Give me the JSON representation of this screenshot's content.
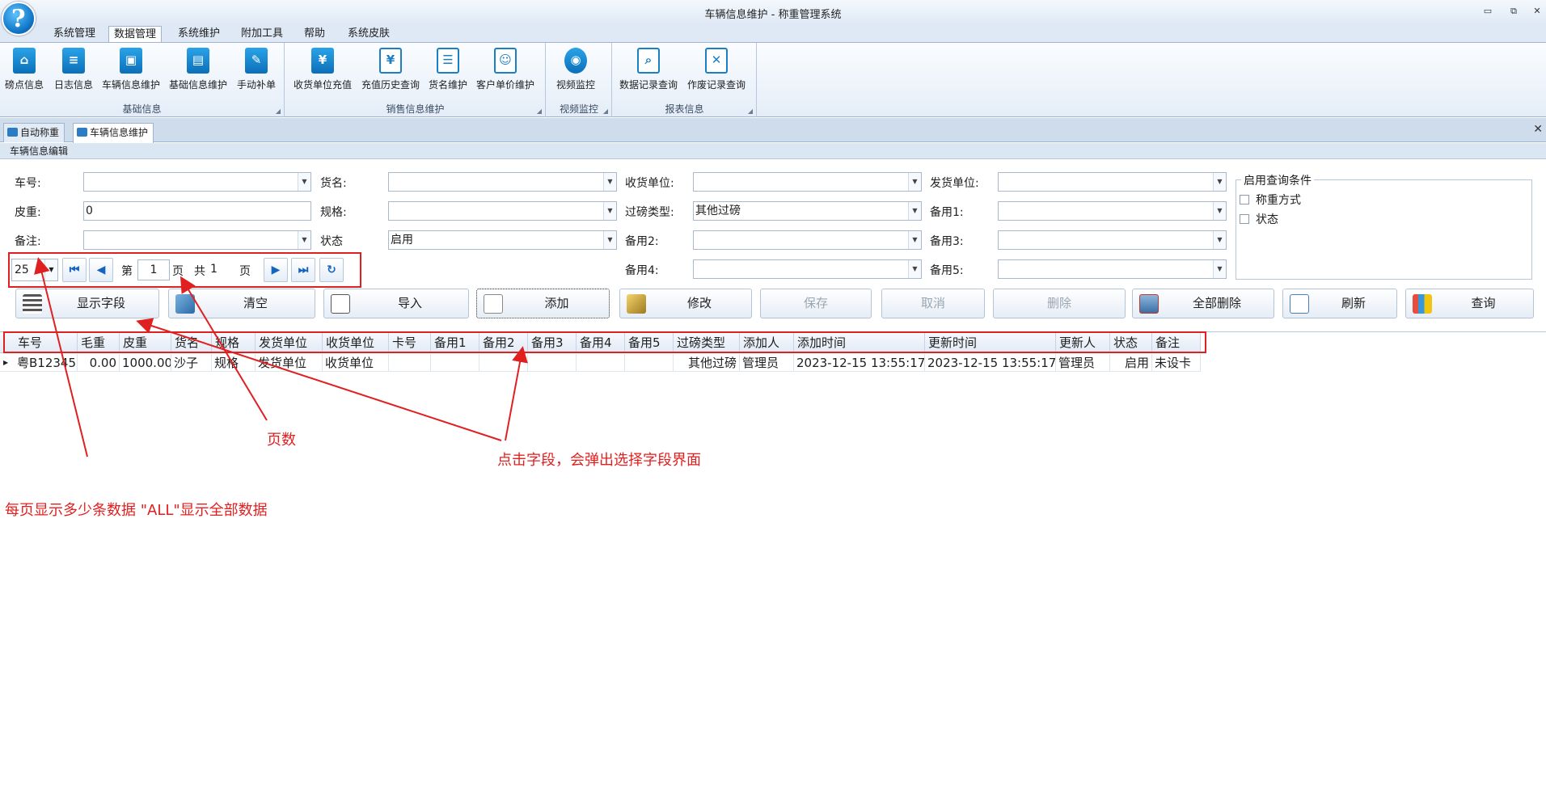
{
  "window": {
    "title": "车辆信息维护 - 称重管理系统",
    "minimize": "▭",
    "restore": "⧉",
    "close": "✕"
  },
  "menu": {
    "tabs": [
      "系统管理",
      "数据管理",
      "系统维护",
      "附加工具",
      "帮助",
      "系统皮肤"
    ],
    "active": "数据管理"
  },
  "ribbon": {
    "groups": [
      {
        "label": "基础信息",
        "buttons": [
          "磅点信息",
          "日志信息",
          "车辆信息维护",
          "基础信息维护",
          "手动补单"
        ]
      },
      {
        "label": "销售信息维护",
        "buttons": [
          "收货单位充值",
          "充值历史查询",
          "货名维护",
          "客户单价维护"
        ]
      },
      {
        "label": "视频监控",
        "buttons": [
          "视频监控"
        ]
      },
      {
        "label": "报表信息",
        "buttons": [
          "数据记录查询",
          "作废记录查询"
        ]
      }
    ],
    "icons": [
      "home-icon",
      "clipboard-icon",
      "truck-icon",
      "card-icon",
      "edit-icon",
      "wallet-icon",
      "yen-clock-icon",
      "goods-icon",
      "user-gear-icon",
      "camera-icon",
      "report-search-icon",
      "void-report-icon"
    ]
  },
  "doc_tabs": [
    "自动称重",
    "车辆信息维护"
  ],
  "doc_close": "✕",
  "section": {
    "title": "车辆信息编辑"
  },
  "form": {
    "labels": {
      "plate": "车号:",
      "goods": "货名:",
      "receiver": "收货单位:",
      "sender": "发货单位:",
      "tare": "皮重:",
      "spec": "规格:",
      "weigh_type": "过磅类型:",
      "backup1": "备用1:",
      "remark": "备注:",
      "status": "状态",
      "backup2": "备用2:",
      "backup3": "备用3:",
      "backup4": "备用4:",
      "backup5": "备用5:"
    },
    "values": {
      "plate": "",
      "goods": "",
      "receiver": "",
      "sender": "",
      "tare": "0",
      "spec": "",
      "weigh_type": "其他过磅",
      "backup1": "",
      "remark": "",
      "status": "启用",
      "backup2": "",
      "backup3": "",
      "backup4": "",
      "backup5": ""
    },
    "query_group": {
      "title": "启用查询条件",
      "options": [
        "称重方式",
        "状态"
      ]
    }
  },
  "pager": {
    "page_size": "25",
    "page_prefix": "第",
    "current_page": "1",
    "page_unit": "页",
    "total_prefix": "共",
    "total_pages": "1",
    "total_unit": "页",
    "buttons": {
      "first": "⏮",
      "prev": "◀",
      "next": "▶",
      "last": "⏭",
      "refresh": "↻"
    }
  },
  "actions": [
    {
      "label": "显示字段",
      "enabled": true,
      "icon": "columns-icon"
    },
    {
      "label": "清空",
      "enabled": true,
      "icon": "eraser-icon"
    },
    {
      "label": "导入",
      "enabled": true,
      "icon": "import-icon"
    },
    {
      "label": "添加",
      "enabled": true,
      "icon": "add-icon"
    },
    {
      "label": "修改",
      "enabled": true,
      "icon": "pencil-icon"
    },
    {
      "label": "保存",
      "enabled": false
    },
    {
      "label": "取消",
      "enabled": false
    },
    {
      "label": "删除",
      "enabled": false
    },
    {
      "label": "全部删除",
      "enabled": true,
      "icon": "delete-all-icon"
    },
    {
      "label": "刷新",
      "enabled": true,
      "icon": "refresh-icon"
    },
    {
      "label": "查询",
      "enabled": true,
      "icon": "query-icon"
    }
  ],
  "grid": {
    "columns": [
      "车号",
      "毛重",
      "皮重",
      "货名",
      "规格",
      "发货单位",
      "收货单位",
      "卡号",
      "备用1",
      "备用2",
      "备用3",
      "备用4",
      "备用5",
      "过磅类型",
      "添加人",
      "添加时间",
      "更新时间",
      "更新人",
      "状态",
      "备注"
    ],
    "rows": [
      [
        "粤B12345",
        "0.00",
        "1000.00",
        "沙子",
        "规格",
        "发货单位",
        "收货单位",
        "",
        "",
        "",
        "",
        "",
        "",
        "其他过磅",
        "管理员",
        "2023-12-15 13:55:17",
        "2023-12-15 13:55:17",
        "管理员",
        "启用",
        "未设卡"
      ]
    ]
  },
  "annotations": {
    "pages": "页数",
    "fields": "点击字段，会弹出选择字段界面",
    "page_size": "每页显示多少条数据 \"ALL\"显示全部数据"
  },
  "colors": {
    "annotation": "#e02020",
    "accent": "#1b7fc4"
  }
}
